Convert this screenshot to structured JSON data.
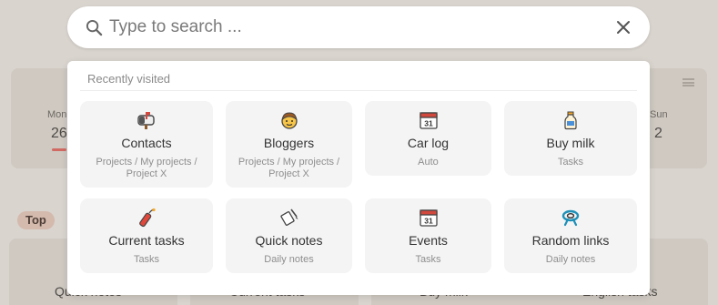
{
  "search": {
    "placeholder": "Type to search ..."
  },
  "recent": {
    "heading": "Recently visited",
    "items": [
      {
        "title": "Contacts",
        "subtitle": "Projects / My projects / Project X",
        "icon": "mailbox-icon"
      },
      {
        "title": "Bloggers",
        "subtitle": "Projects / My projects / Project X",
        "icon": "face-icon"
      },
      {
        "title": "Car log",
        "subtitle": "Auto",
        "icon": "calendar-icon"
      },
      {
        "title": "Buy milk",
        "subtitle": "Tasks",
        "icon": "milk-bottle-icon"
      },
      {
        "title": "Current tasks",
        "subtitle": "Tasks",
        "icon": "firecracker-icon"
      },
      {
        "title": "Quick notes",
        "subtitle": "Daily notes",
        "icon": "note-pencil-icon"
      },
      {
        "title": "Events",
        "subtitle": "Tasks",
        "icon": "calendar-icon"
      },
      {
        "title": "Random links",
        "subtitle": "Daily notes",
        "icon": "knot-icon"
      }
    ]
  },
  "background": {
    "days": [
      "Mon",
      "Sun"
    ],
    "day_numbers": [
      "26",
      "2"
    ],
    "top_badge": "Top",
    "cards": [
      "Quick notes",
      "Current tasks",
      "Buy milk",
      "English tasks"
    ]
  },
  "colors": {
    "overlay": "#d9d4ce",
    "panel": "#ffffff",
    "tile": "#f4f4f4",
    "accent_today": "#d16a63"
  }
}
